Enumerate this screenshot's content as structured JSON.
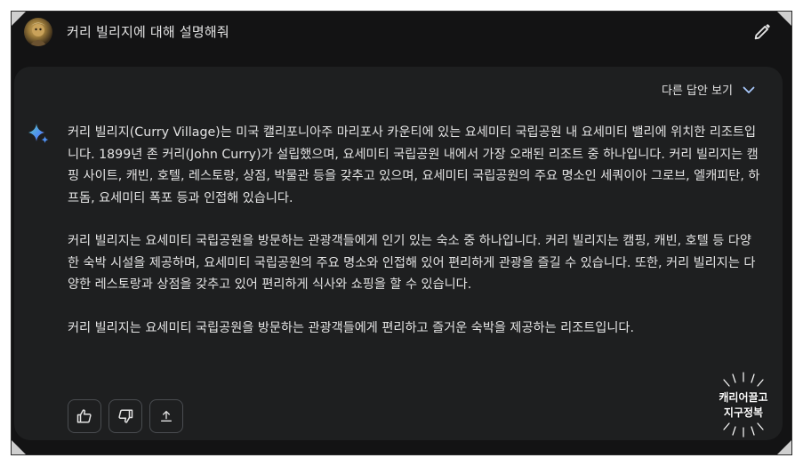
{
  "prompt": {
    "text": "커리 빌리지에 대해 설명해줘"
  },
  "response": {
    "drafts_label": "다른 답안 보기",
    "paragraphs": [
      "커리 빌리지(Curry Village)는 미국 캘리포니아주 마리포사 카운티에 있는 요세미티 국립공원 내 요세미티 밸리에 위치한 리조트입니다. 1899년 존 커리(John Curry)가 설립했으며, 요세미티 국립공원 내에서 가장 오래된 리조트 중 하나입니다. 커리 빌리지는 캠핑 사이트, 캐빈, 호텔, 레스토랑, 상점, 박물관 등을 갖추고 있으며, 요세미티 국립공원의 주요 명소인 세쿼이아 그로브, 엘캐피탄, 하프돔, 요세미티 폭포 등과 인접해 있습니다.",
      "커리 빌리지는 요세미티 국립공원을 방문하는 관광객들에게 인기 있는 숙소 중 하나입니다. 커리 빌리지는 캠핑, 캐빈, 호텔 등 다양한 숙박 시설을 제공하며, 요세미티 국립공원의 주요 명소와 인접해 있어 편리하게 관광을 즐길 수 있습니다. 또한, 커리 빌리지는 다양한 레스토랑과 상점을 갖추고 있어 편리하게 식사와 쇼핑을 할 수 있습니다.",
      "커리 빌리지는 요세미티 국립공원을 방문하는 관광객들에게 편리하고 즐거운 숙박을 제공하는 리조트입니다."
    ]
  },
  "actions": {
    "thumbs_up_icon": "thumbs-up-icon",
    "thumbs_down_icon": "thumbs-down-icon",
    "share_icon": "share-icon"
  },
  "watermark": {
    "line1": "캐리어끌고",
    "line2": "지구정복"
  },
  "colors": {
    "page_bg": "#131314",
    "card_bg": "#1e1f20",
    "text": "#e3e3e3",
    "sparkle_blue": "#4f8ff0",
    "sparkle_teal": "#5fc9c0"
  }
}
